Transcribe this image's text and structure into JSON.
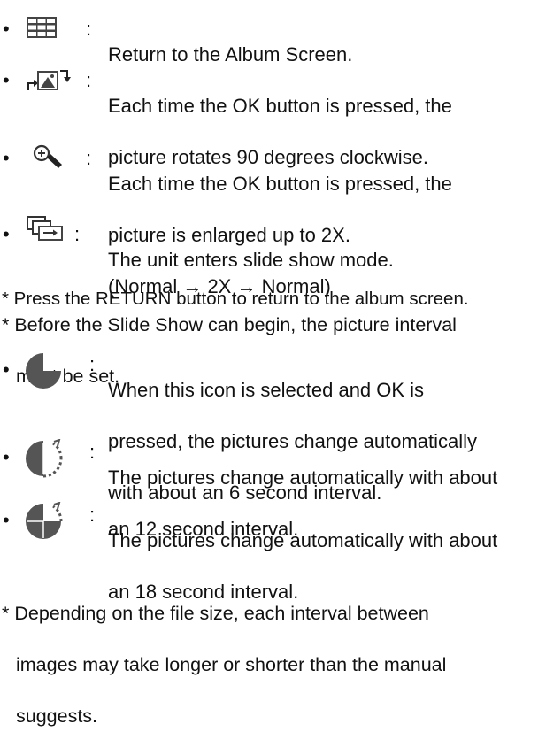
{
  "items": [
    {
      "icon": "album-grid-icon",
      "lines": [
        "Return to the Album Screen."
      ]
    },
    {
      "icon": "rotate-picture-icon",
      "lines": [
        "Each time the OK button is pressed, the",
        "picture rotates 90 degrees clockwise."
      ]
    },
    {
      "icon": "zoom-in-icon",
      "lines": [
        "Each time the OK button is pressed, the",
        "picture is enlarged up to 2X.",
        "(Normal → 2X → Normal)"
      ]
    },
    {
      "icon": "slideshow-icon",
      "lines": [
        "The unit enters slide show mode."
      ]
    }
  ],
  "notes": [
    {
      "lines": [
        "* Press the RETURN button to return to the album screen."
      ]
    },
    {
      "lines": [
        "* Before the Slide Show can begin, the picture interval",
        "must be set."
      ]
    }
  ],
  "interval_items": [
    {
      "icon": "interval-6s-icon",
      "lines": [
        "When this icon is selected and OK is",
        "pressed, the pictures change automatically",
        "with about an 6 second interval."
      ]
    },
    {
      "icon": "interval-12s-icon",
      "lines": [
        "The pictures change automatically with about",
        "an 12 second interval."
      ]
    },
    {
      "icon": "interval-18s-icon",
      "lines": [
        "The pictures change automatically with about",
        "an 18 second interval."
      ]
    }
  ],
  "footer_note": {
    "lines": [
      "* Depending on the file size, each interval between",
      "images may take longer or shorter than the manual",
      "suggests."
    ]
  },
  "bullet": "•",
  "colon": ":",
  "colors": {
    "text": "#111111",
    "icon_dark": "#444444",
    "icon_mid": "#666666"
  }
}
